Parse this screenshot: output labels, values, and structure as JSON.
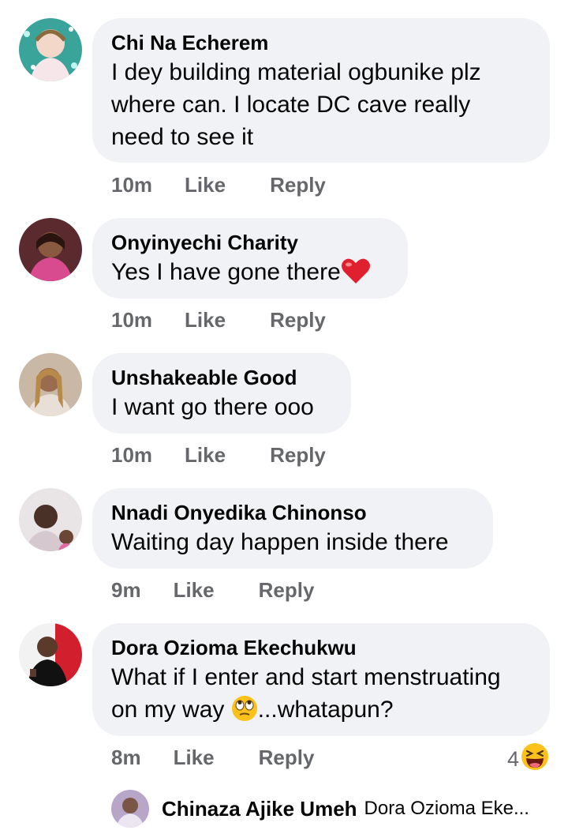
{
  "comments": [
    {
      "name": "Chi Na Echerem",
      "text_lines": [
        "I dey building material ogbunike plz",
        "where can. I locate DC cave really",
        "need to see it"
      ],
      "time": "10m",
      "like": "Like",
      "reply": "Reply"
    },
    {
      "name": "Onyinyechi Charity",
      "text": "Yes I have gone there",
      "emoji": "heart-emoji",
      "time": "10m",
      "like": "Like",
      "reply": "Reply"
    },
    {
      "name": "Unshakeable Good",
      "text": "I want go there ooo",
      "time": "10m",
      "like": "Like",
      "reply": "Reply"
    },
    {
      "name": "Nnadi Onyedika Chinonso",
      "text": "Waiting day happen inside there",
      "time": "9m",
      "like": "Like",
      "reply": "Reply"
    },
    {
      "name": "Dora Ozioma Ekechukwu",
      "text_line1": "What if I enter and start menstruating",
      "text_line2_pre": "on my way ",
      "text_line2_post": "...whatapun?",
      "emoji": "face-with-rolling-eyes-emoji",
      "time": "8m",
      "like": "Like",
      "reply": "Reply",
      "reaction_count": "4",
      "reaction_icon": "laughing-emoji"
    }
  ],
  "reply_preview": {
    "name": "Chinaza Ajike Umeh",
    "text": "Dora Ozioma Eke..."
  },
  "colors": {
    "bubble": "#f0f2f5",
    "meta_text": "#65676b",
    "heart": "#e0202e"
  }
}
